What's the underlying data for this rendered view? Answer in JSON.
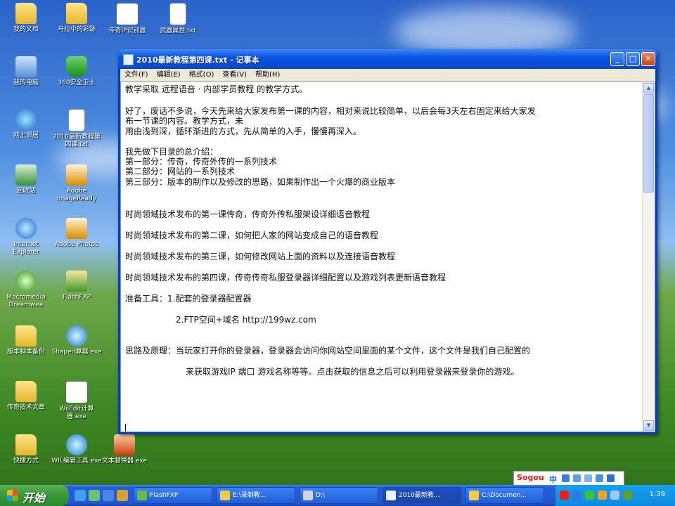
{
  "desktop": {
    "icons": [
      {
        "label": "我的文档",
        "icon": "folder-icon"
      },
      {
        "label": "马拉中的彩跡",
        "icon": "folder-icon"
      },
      {
        "label": "传奇IP识别器",
        "icon": "app-icon"
      },
      {
        "label": "武器属性 txt",
        "icon": "text-file-icon"
      },
      {
        "label": "我的电脑",
        "icon": "computer-icon"
      },
      {
        "label": "360安全卫士",
        "icon": "shield-icon"
      },
      {
        "label": "网上邻居",
        "icon": "network-icon"
      },
      {
        "label": "2010最新教程第四课.txt",
        "icon": "text-file-icon"
      },
      {
        "label": "回收站",
        "icon": "recycle-bin-icon"
      },
      {
        "label": "Adobe ImageReady",
        "icon": "adobe-icon"
      },
      {
        "label": "Internet Explorer",
        "icon": "ie-icon"
      },
      {
        "label": "Adobe Photos",
        "icon": "adobe-icon"
      },
      {
        "label": "Macromedia Dreamwea",
        "icon": "dreamweaver-icon"
      },
      {
        "label": "FlashFXP",
        "icon": "flashfxp-icon"
      },
      {
        "label": "版本脚本备份",
        "icon": "folder-icon"
      },
      {
        "label": "Shapeit算器 exe",
        "icon": "app-icon"
      },
      {
        "label": "传奇技术文章",
        "icon": "folder-icon"
      },
      {
        "label": "WilEdit计算器.exe",
        "icon": "app-icon"
      },
      {
        "label": "快捷方式",
        "icon": "folder-icon"
      },
      {
        "label": "WIL编辑工具 exe",
        "icon": "app-icon"
      },
      {
        "label": "文本替换器 exe",
        "icon": "app-icon"
      }
    ]
  },
  "window": {
    "title": "2010最新教程第四课.txt - 记事本",
    "buttons": {
      "minimize": "_",
      "maximize": "□",
      "close": "✕"
    },
    "menu": [
      "文件(F)",
      "编辑(E)",
      "格式(O)",
      "查看(V)",
      "帮助(H)"
    ],
    "lines": [
      "教学采取  远程语音 · 内部学员教程 的教学方式。",
      "好了，废话不多说，今天先来给大家发布第一课的内容，相对来说比较简单，以后会每3天左右固定来给大家发",
      "布一节课的内容。教学方式，未",
      "用由浅到深，循环渐进的方式，先从简单的入手，慢慢再深入。",
      "我先做下目录的总介绍：",
      "第一部分：传奇，传奇外传的一系列技术",
      "第二部分：网站的一系列技术",
      "第三部分：版本的制作以及修改的思路，如果制作出一个火爆的商业版本",
      "时尚领域技术发布的第一课传奇，传奇外传私服架设详细语音教程",
      "时尚领域技术发布的第二课，如何把人家的网站变成自己的语音教程",
      "时尚领域技术发布的第三课，如何修改网站上面的资料以及连接语音教程",
      "时尚领域技术发布的第四课，传奇传奇私服登录器详细配置以及游戏列表更新语音教程",
      "准备工具：1.配套的登录器配置器",
      "2.FTP空间+域名  http://199wz.com",
      "思路及原理：当玩家打开你的登录器，登录器会访问你网站空间里面的某个文件，这个文件是我们自己配置的",
      "来获取游戏IP  端口 游戏名称等等。点击获取的信息之后可以利用登录器来登录你的游戏。"
    ]
  },
  "taskbar": {
    "start_label": "开始",
    "tasks": [
      {
        "label": "FlashFXP",
        "icon": "flashfxp-icon"
      },
      {
        "label": "E:\\录制教...",
        "icon": "folder-icon"
      },
      {
        "label": "D:\\",
        "icon": "drive-icon"
      },
      {
        "label": "2010最新教...",
        "icon": "notepad-icon"
      },
      {
        "label": "C:\\Documen...",
        "icon": "folder-icon"
      }
    ],
    "clock": "1:39"
  },
  "ime": {
    "brand": "Sogou",
    "mode": "中"
  }
}
